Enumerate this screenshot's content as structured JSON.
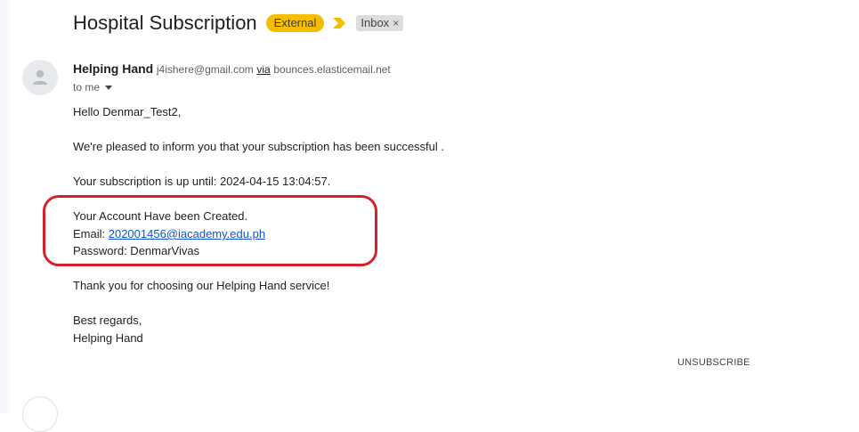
{
  "email": {
    "subject": "Hospital Subscription",
    "labels": {
      "external": "External",
      "inbox": "Inbox",
      "remove_label": "×"
    },
    "sender": {
      "name": "Helping Hand",
      "email": "j4ishere@gmail.com",
      "via_label": "via",
      "via_domain": "bounces.elasticemail.net"
    },
    "recipient_label": "to me",
    "body": {
      "greeting": "Hello Denmar_Test2,",
      "line1": "We're pleased to inform you that your subscription has been successful .",
      "line2": "Your subscription is up until: 2024-04-15 13:04:57.",
      "account_created": "Your Account Have been Created.",
      "email_label": "Email: ",
      "email_value": "202001456@iacademy.edu.ph",
      "password_line": "Password: DenmarVivas",
      "thanks": "Thank you for choosing our Helping Hand service!",
      "regards": "Best regards,",
      "signature": "Helping Hand"
    },
    "unsubscribe": "UNSUBSCRIBE"
  },
  "colors": {
    "external_badge": "#f5bf00",
    "important_marker": "#f5bf00",
    "highlight_box": "#d8202b",
    "link": "#1155cc"
  }
}
